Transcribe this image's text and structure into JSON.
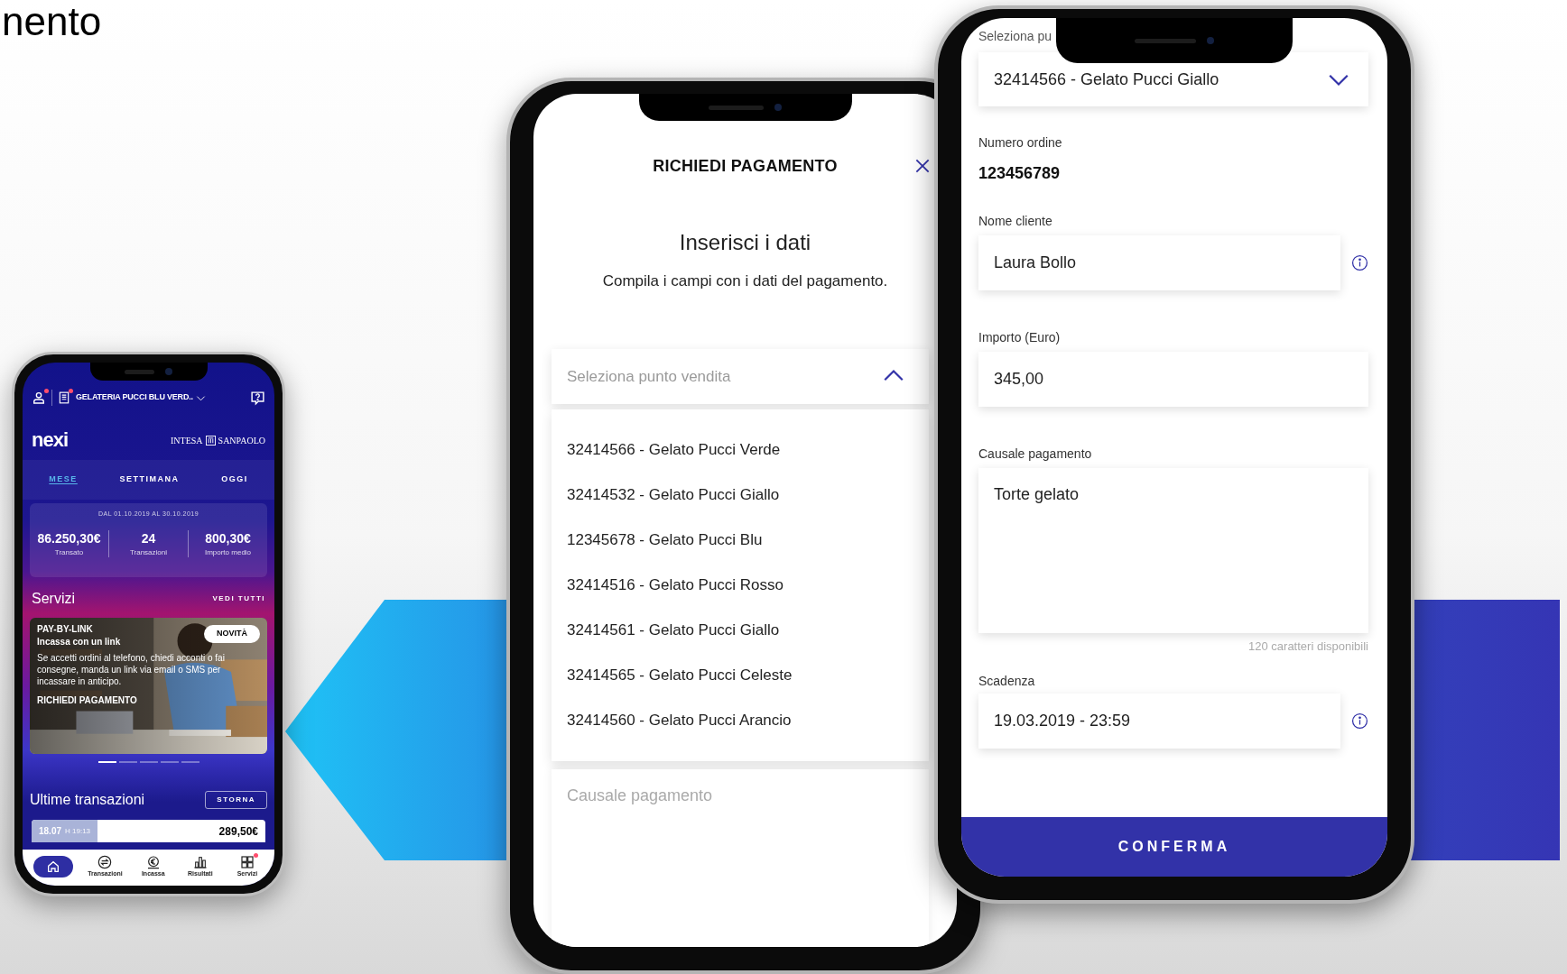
{
  "slide_title": "nento",
  "home_screen": {
    "header": {
      "store_name": "GELATERIA PUCCI BLU VERD..",
      "profile_badge": true,
      "receipts_badge": true
    },
    "brand": {
      "logo": "nexi",
      "bank_name_left": "INTESA",
      "bank_name_right": "SANPAOLO"
    },
    "period_tabs": [
      {
        "label": "MESE",
        "selected": true
      },
      {
        "label": "SETTIMANA",
        "selected": false
      },
      {
        "label": "OGGI",
        "selected": false
      }
    ],
    "period_range": "DAL 01.10.2019 AL 30.10.2019",
    "stats": [
      {
        "value": "86.250,30€",
        "label": "Transato"
      },
      {
        "value": "24",
        "label": "Transazioni"
      },
      {
        "value": "800,30€",
        "label": "Importo medio"
      }
    ],
    "services": {
      "title": "Servizi",
      "link": "VEDI TUTTI"
    },
    "promo": {
      "kind": "picture",
      "title": "PAY-BY-LINK",
      "subtitle": "Incassa con un link",
      "text": "Se accetti ordini al telefono, chiedi acconti o fai consegne, manda un link via email o SMS per incassare in anticipo.",
      "action": "RICHIEDI PAGAMENTO",
      "badge": "NOVITÀ"
    },
    "carousel": [
      {
        "selected": true
      },
      {
        "selected": false
      },
      {
        "selected": false
      },
      {
        "selected": false
      },
      {
        "selected": false
      }
    ],
    "transactions": {
      "title": "Ultime transazioni",
      "button": "STORNA",
      "rows": [
        {
          "date": "18.07",
          "time": "H 19:13",
          "amount": "289,50€"
        }
      ]
    },
    "nav": [
      {
        "selected": true,
        "badge": false
      },
      {
        "label": "Transazioni",
        "selected": false,
        "badge": false
      },
      {
        "label": "Incassa",
        "selected": false,
        "badge": false
      },
      {
        "label": "Risultati",
        "selected": false,
        "badge": false
      },
      {
        "label": "Servizi",
        "selected": false,
        "badge": true
      }
    ]
  },
  "request_screen": {
    "title": "RICHIEDI PAGAMENTO",
    "heading": "Inserisci i dati",
    "subtitle": "Compila i campi con i dati del pagamento.",
    "store_select": {
      "placeholder": "Seleziona punto vendita",
      "expanded": true
    },
    "store_options": [
      "32414566 - Gelato Pucci Verde",
      "32414532 - Gelato Pucci Giallo",
      "12345678 - Gelato Pucci Blu",
      "32414516 - Gelato Pucci Rosso",
      "32414561 - Gelato Pucci Giallo",
      "32414565 - Gelato Pucci Celeste",
      "32414560 - Gelato Pucci Arancio"
    ],
    "reason": {
      "placeholder": "Causale pagamento"
    }
  },
  "form_screen": {
    "store_label": "Seleziona pu",
    "store_select": {
      "value": "32414566 - Gelato Pucci Giallo",
      "expanded": false
    },
    "order": {
      "label": "Numero ordine",
      "value": "123456789"
    },
    "customer": {
      "label": "Nome cliente",
      "value": "Laura Bollo"
    },
    "amount": {
      "label": "Importo (Euro)",
      "value": "345,00"
    },
    "reason": {
      "label": "Causale pagamento",
      "value": "Torte gelato",
      "counter": "120 caratteri disponibili"
    },
    "expiry": {
      "label": "Scadenza",
      "value": "19.03.2019 - 23:59"
    },
    "confirm": "CONFERMA"
  }
}
